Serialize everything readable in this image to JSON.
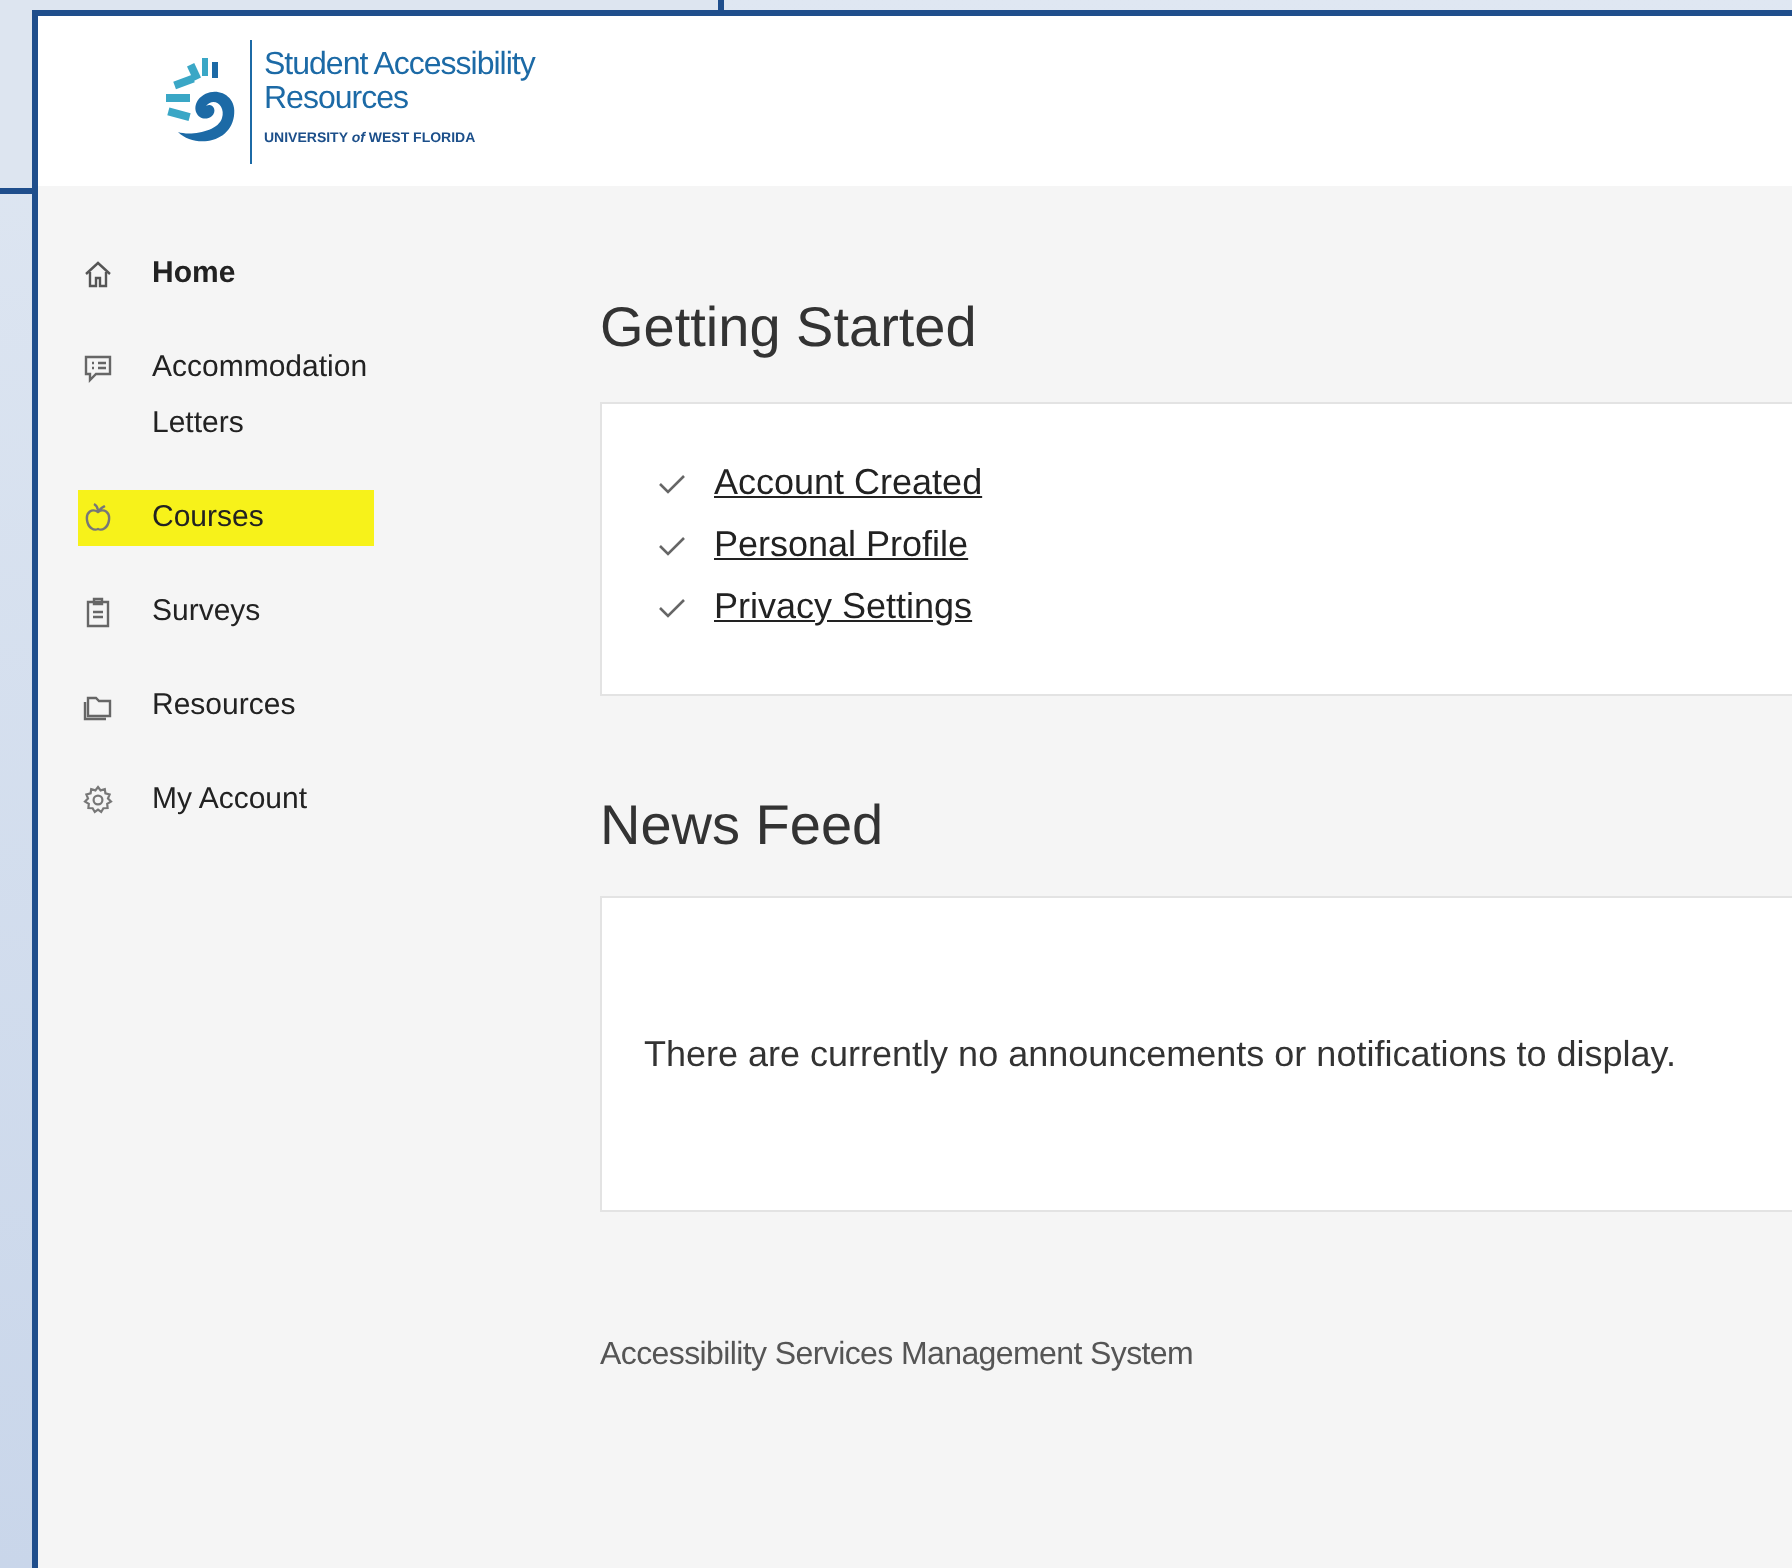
{
  "logo": {
    "line_1": "Student Accessibility",
    "line_2": "Resources",
    "line_3": "UNIVERSITY *of* WEST FLORIDA"
  },
  "sidebar": {
    "items": [
      {
        "label": "Home",
        "selected": true,
        "highlighted": false
      },
      {
        "label": "Accommodation Letters",
        "selected": false,
        "highlighted": false
      },
      {
        "label": "Courses",
        "selected": false,
        "highlighted": true
      },
      {
        "label": "Surveys",
        "selected": false,
        "highlighted": false
      },
      {
        "label": "Resources",
        "selected": false,
        "highlighted": false
      },
      {
        "label": "My Account",
        "selected": false,
        "highlighted": false
      }
    ]
  },
  "getting_started": {
    "title": "Getting Started",
    "steps": [
      {
        "label": "Account Created",
        "checked": true
      },
      {
        "label": "Personal Profile",
        "checked": true
      },
      {
        "label": "Privacy Settings",
        "checked": true
      }
    ]
  },
  "news_feed": {
    "title": "News Feed",
    "message": "There are currently no announcements or notifications to display."
  },
  "footer": "Accessibility Services Management System"
}
